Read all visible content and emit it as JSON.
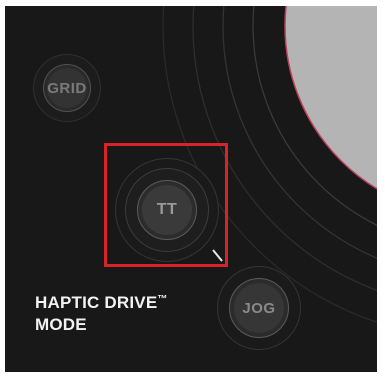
{
  "controller": {
    "knobs": {
      "grid_label": "GRID",
      "tt_label": "TT",
      "jog_label": "JOG"
    },
    "mode_label_line1": "HAPTIC DRIVE",
    "mode_label_trademark": "™",
    "mode_label_line2": "MODE"
  },
  "colors": {
    "panel_background": "#181818",
    "highlight": "#d9232b",
    "platter": "#b4b4b4",
    "platter_edge": "#c0405a",
    "label_text": "#f2f2f2",
    "knob_text": "#8a8a8a"
  }
}
